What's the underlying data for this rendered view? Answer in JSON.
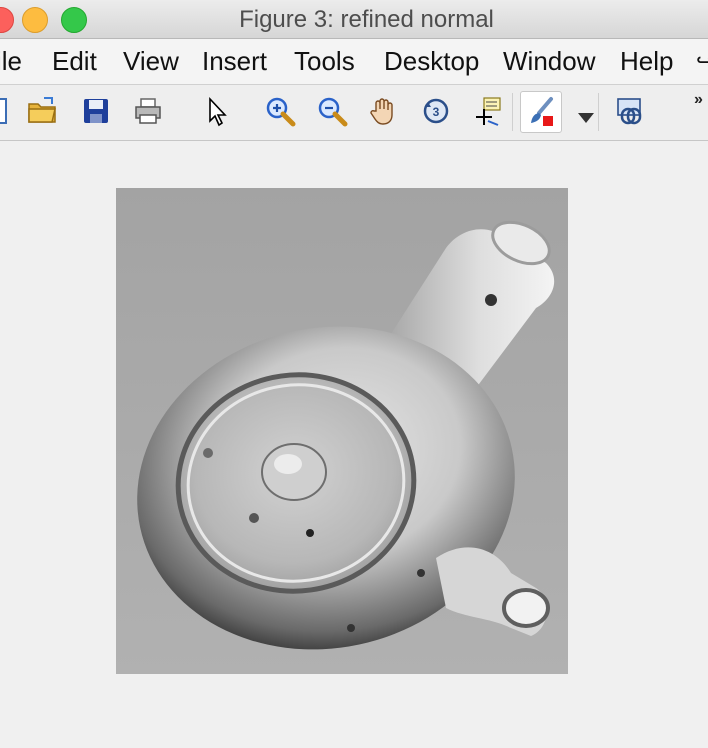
{
  "window": {
    "title": "Figure 3: refined normal"
  },
  "menubar": {
    "items": [
      {
        "label": "ile"
      },
      {
        "label": "Edit"
      },
      {
        "label": "View"
      },
      {
        "label": "Insert"
      },
      {
        "label": "Tools"
      },
      {
        "label": "Desktop"
      },
      {
        "label": "Window"
      },
      {
        "label": "Help"
      }
    ],
    "overflow_icon": "menu-overflow-arrow"
  },
  "toolbar": {
    "buttons": [
      {
        "icon": "new-figure-icon"
      },
      {
        "icon": "open-folder-icon"
      },
      {
        "icon": "save-icon"
      },
      {
        "icon": "print-icon"
      },
      {
        "icon": "pointer-icon"
      },
      {
        "icon": "zoom-in-icon"
      },
      {
        "icon": "zoom-out-icon"
      },
      {
        "icon": "pan-hand-icon"
      },
      {
        "icon": "rotate-3d-icon"
      },
      {
        "icon": "data-cursor-icon"
      },
      {
        "icon": "brush-icon"
      },
      {
        "icon": "dropdown-arrow-icon"
      },
      {
        "icon": "link-plot-icon"
      },
      {
        "icon": "toolbar-overflow-icon"
      }
    ]
  },
  "figure": {
    "image": {
      "subject": "teapot-normal-map",
      "colormap": "gray"
    }
  },
  "colors": {
    "close": "#fc605c",
    "minimize": "#fdbc40",
    "maximize": "#34c84a",
    "background": "#f0f0f0"
  }
}
